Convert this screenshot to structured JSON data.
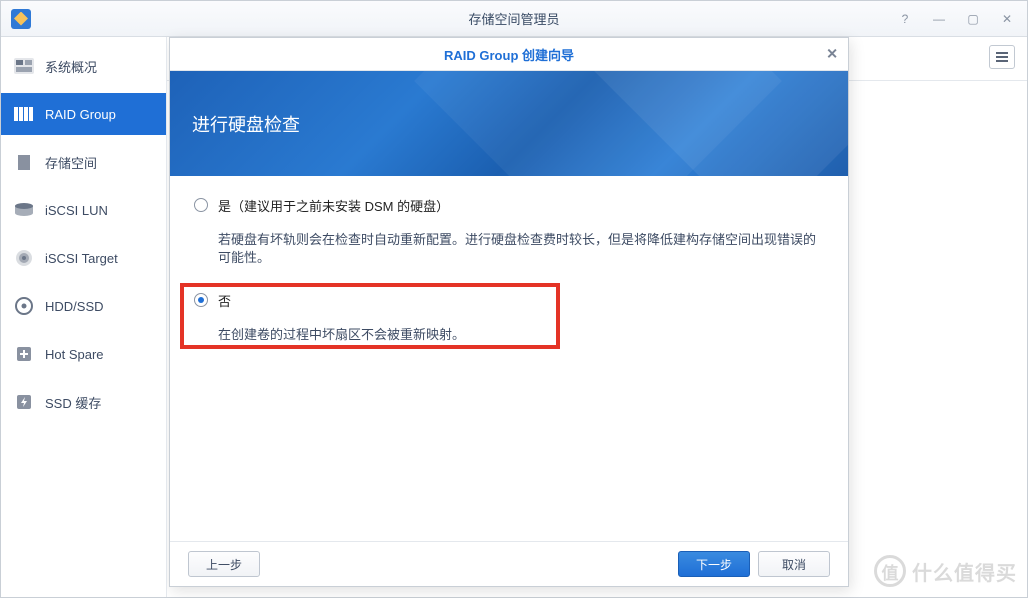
{
  "window": {
    "title": "存储空间管理员"
  },
  "sidebar": {
    "items": [
      {
        "label": "系统概况",
        "icon": "overview-icon"
      },
      {
        "label": "RAID Group",
        "icon": "raid-group-icon",
        "active": true
      },
      {
        "label": "存储空间",
        "icon": "storage-icon"
      },
      {
        "label": "iSCSI LUN",
        "icon": "iscsi-lun-icon"
      },
      {
        "label": "iSCSI Target",
        "icon": "iscsi-target-icon"
      },
      {
        "label": "HDD/SSD",
        "icon": "hdd-ssd-icon"
      },
      {
        "label": "Hot Spare",
        "icon": "hot-spare-icon"
      },
      {
        "label": "SSD 缓存",
        "icon": "ssd-cache-icon"
      }
    ]
  },
  "wizard": {
    "title": "RAID Group 创建向导",
    "banner_title": "进行硬盘检查",
    "option_yes": {
      "label": "是（建议用于之前未安装 DSM 的硬盘）",
      "desc": "若硬盘有坏轨则会在检查时自动重新配置。进行硬盘检查费时较长，但是将降低建构存储空间出现错误的可能性。",
      "checked": false
    },
    "option_no": {
      "label": "否",
      "desc": "在创建卷的过程中坏扇区不会被重新映射。",
      "checked": true
    },
    "buttons": {
      "back": "上一步",
      "next": "下一步",
      "cancel": "取消"
    }
  },
  "watermark": "什么值得买"
}
